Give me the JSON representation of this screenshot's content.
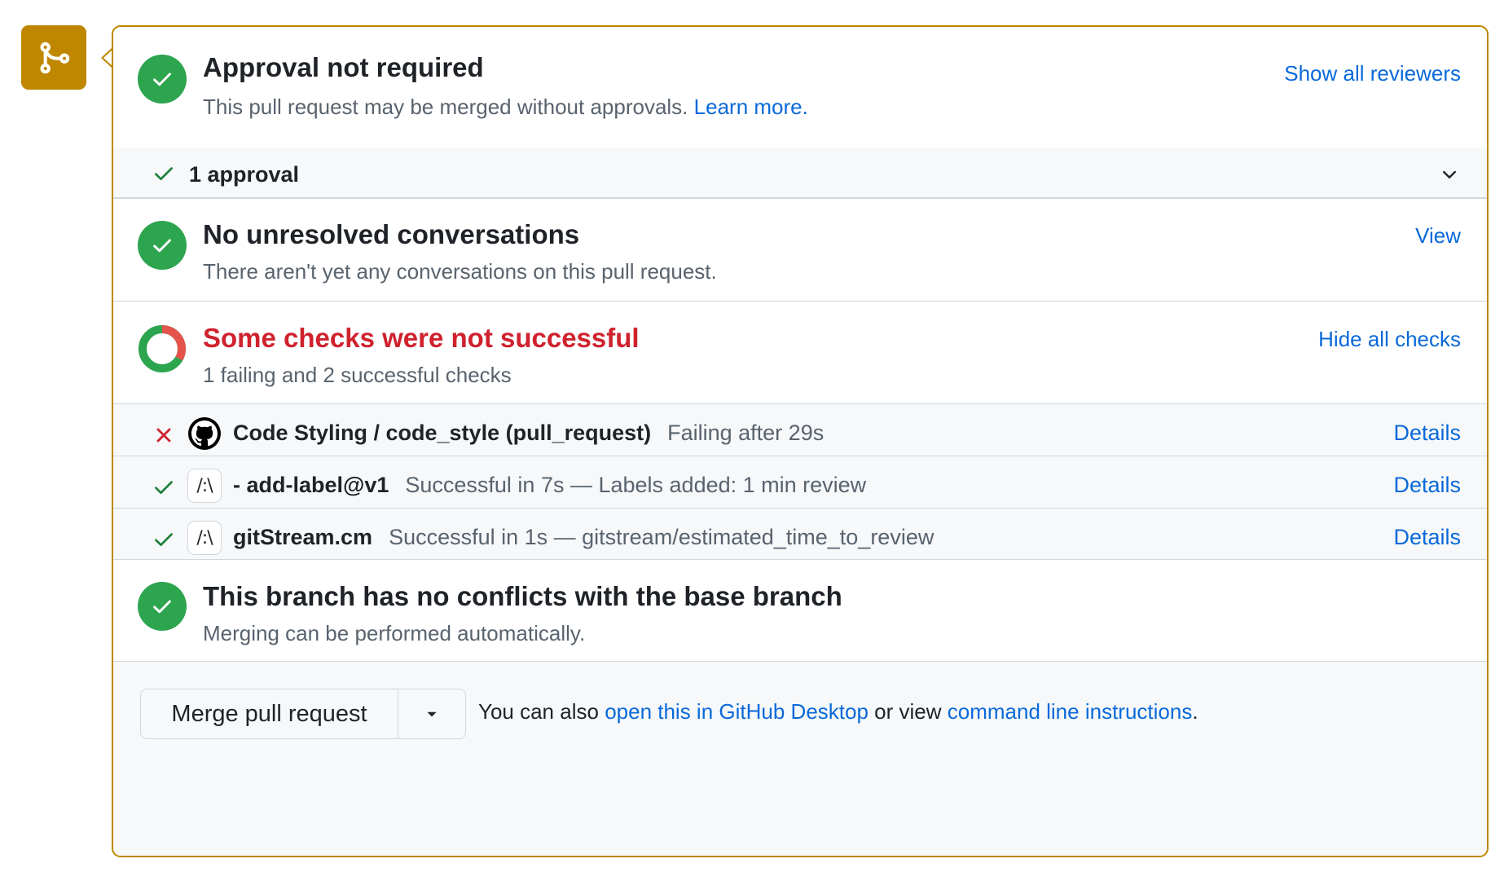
{
  "colors": {
    "accent_attention": "#bf8700",
    "success": "#2da44e",
    "danger": "#cf222e",
    "link": "#0969da",
    "muted_text": "#59636e",
    "subtle_bg": "#f6f8fa"
  },
  "merge_badge": {
    "icon": "git-merge-icon"
  },
  "approval": {
    "title": "Approval not required",
    "subtitle": "This pull request may be merged without approvals.",
    "learn_more": "Learn more.",
    "action": "Show all reviewers",
    "icon": "check-circle-icon"
  },
  "approvals_bar": {
    "label": "1 approval",
    "icon": "check-icon",
    "toggle_icon": "chevron-down-icon"
  },
  "conversations": {
    "title": "No unresolved conversations",
    "subtitle": "There aren't yet any conversations on this pull request.",
    "action": "View",
    "icon": "check-circle-icon"
  },
  "checks": {
    "title": "Some checks were not successful",
    "subtitle": "1 failing and 2 successful checks",
    "action": "Hide all checks",
    "icon": "partial-status-ring-icon",
    "items": [
      {
        "status": "failure",
        "status_icon": "x-icon",
        "avatar": "github-logo",
        "avatar_text": "",
        "name": "Code Styling / code_style (pull_request)",
        "description": "Failing after 29s",
        "details": "Details"
      },
      {
        "status": "success",
        "status_icon": "check-icon",
        "avatar": "gitstream-logo",
        "avatar_text": "/:\\",
        "name": "- add-label@v1",
        "description": "Successful in 7s — Labels added: 1 min review",
        "details": "Details"
      },
      {
        "status": "success",
        "status_icon": "check-icon",
        "avatar": "gitstream-logo",
        "avatar_text": "/:\\",
        "name": "gitStream.cm",
        "description": "Successful in 1s — gitstream/estimated_time_to_review",
        "details": "Details"
      }
    ]
  },
  "conflicts": {
    "title": "This branch has no conflicts with the base branch",
    "subtitle": "Merging can be performed automatically.",
    "icon": "check-circle-icon"
  },
  "merge": {
    "button_label": "Merge pull request",
    "dropdown_icon": "triangle-down-icon",
    "note_prefix": "You can also",
    "desktop_link": "open this in GitHub Desktop",
    "note_middle": "or view",
    "cli_link": "command line instructions",
    "note_suffix": "."
  }
}
